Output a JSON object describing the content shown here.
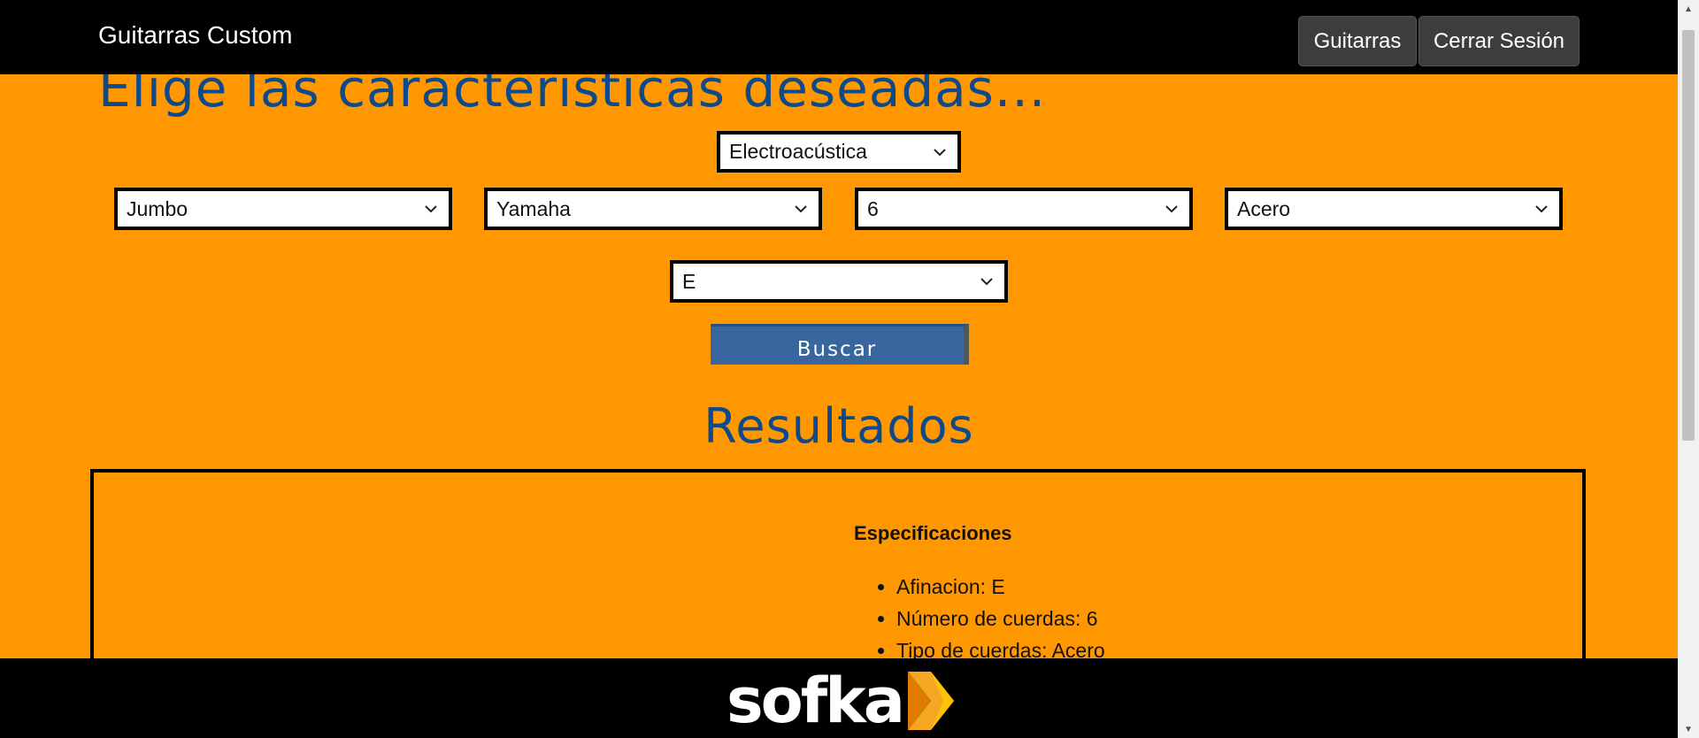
{
  "navbar": {
    "brand": "Guitarras Custom",
    "guitarras_label": "Guitarras",
    "logout_label": "Cerrar Sesión"
  },
  "form": {
    "heading": "Elige las caracteristicas deseadas...",
    "tipo": "Electroacústica",
    "forma": "Jumbo",
    "marca": "Yamaha",
    "cuerdas": "6",
    "material": "Acero",
    "afinacion": "E",
    "buscar_label": "Buscar"
  },
  "results": {
    "title": "Resultados",
    "spec_title": "Especificaciones",
    "specs": [
      "Afinacion: E",
      "Número de cuerdas: 6",
      "Tipo de cuerdas: Acero"
    ]
  },
  "footer": {
    "logo_text": "sofka"
  },
  "colors": {
    "background": "#ff9800",
    "heading": "#0d4a8c",
    "button": "#3a66a0",
    "bar": "#000000",
    "logo_accent": "#f5a623"
  }
}
